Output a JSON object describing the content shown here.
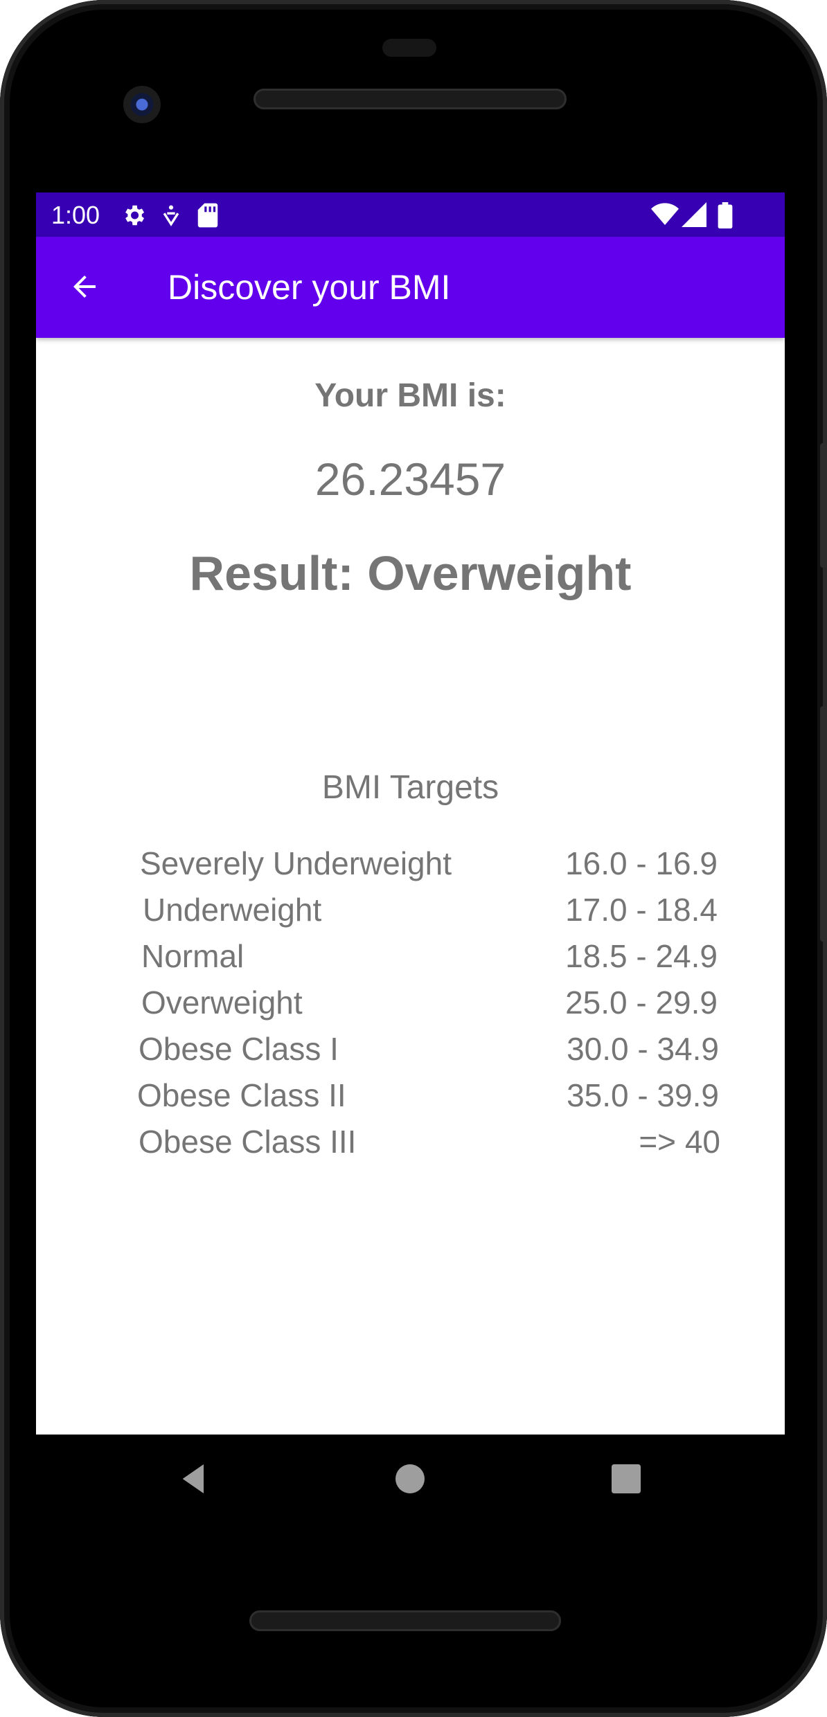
{
  "status_bar": {
    "time": "1:00",
    "left_icons": [
      "gear-icon",
      "accessibility-icon",
      "sd-card-icon"
    ],
    "right_icons": [
      "wifi-icon",
      "signal-icon",
      "battery-icon"
    ]
  },
  "toolbar": {
    "title": "Discover your BMI",
    "back_icon": "arrow-left-icon"
  },
  "result": {
    "label": "Your BMI is:",
    "value": "26.23457",
    "category": "Result: Overweight"
  },
  "targets": {
    "heading": "BMI Targets",
    "rows": [
      {
        "category": "Severely Underweight",
        "range": "16.0 - 16.9"
      },
      {
        "category": "Underweight",
        "range": "17.0 - 18.4"
      },
      {
        "category": "Normal",
        "range": "18.5 - 24.9"
      },
      {
        "category": "Overweight",
        "range": "25.0 - 29.9"
      },
      {
        "category": "Obese Class I",
        "range": "30.0 - 34.9"
      },
      {
        "category": "Obese Class II",
        "range": "35.0 - 39.9"
      },
      {
        "category": "Obese Class III",
        "range": "=> 40"
      }
    ]
  },
  "nav_bar": {
    "icons": [
      "back-triangle-icon",
      "home-circle-icon",
      "recents-square-icon"
    ]
  },
  "colors": {
    "status_bar": "#3700b3",
    "toolbar": "#6200ee",
    "text": "#757575"
  }
}
